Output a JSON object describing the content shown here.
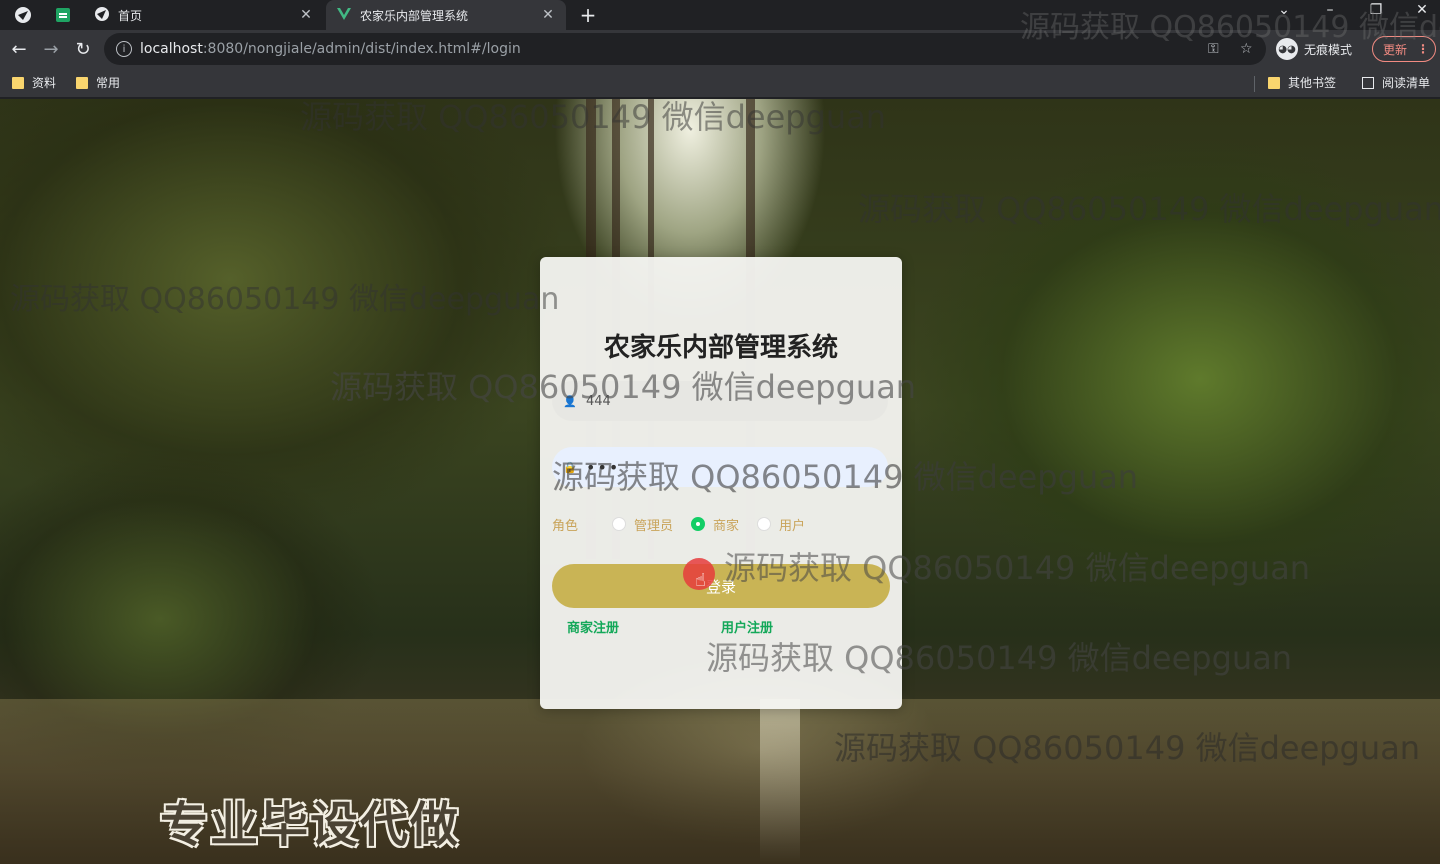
{
  "browser": {
    "tabs": [
      {
        "title": "首页",
        "active": false
      },
      {
        "title": "农家乐内部管理系统",
        "active": true
      }
    ],
    "url_host": "localhost",
    "url_rest": ":8080/nongjiale/admin/dist/index.html#/login",
    "incognito_label": "无痕模式",
    "update_label": "更新",
    "bookmarks": {
      "left": [
        "资料",
        "常用"
      ],
      "right": [
        "其他书签",
        "阅读清单"
      ]
    }
  },
  "login": {
    "title": "农家乐内部管理系统",
    "username_value": "444",
    "password_value": "•••",
    "role_label": "角色",
    "roles": [
      "管理员",
      "商家",
      "用户"
    ],
    "selected_role": "商家",
    "login_button": "登录",
    "register_merchant": "商家注册",
    "register_user": "用户注册"
  },
  "overlay": {
    "watermark_text": "源码获取 QQ86050149 微信deepguan",
    "promo_text": "专业毕设代做"
  },
  "colors": {
    "accent_gold": "#c9b455",
    "link_green": "#13a859",
    "radio_green": "#13ce66"
  }
}
